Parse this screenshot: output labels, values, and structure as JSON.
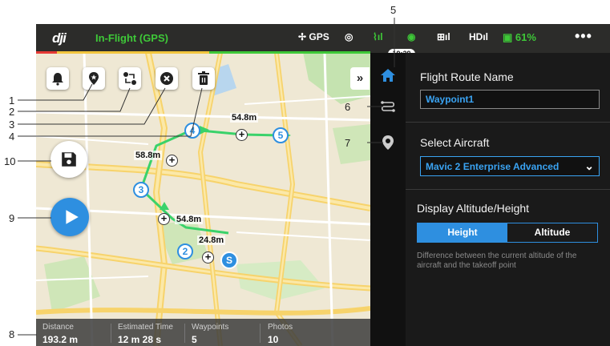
{
  "app": {
    "logo": "dji",
    "status": "In-Flight (GPS)"
  },
  "topbar": {
    "gps_label": "GPS",
    "battery": "61%",
    "more": "•••",
    "clock": "19:29"
  },
  "icons": {
    "bell": "bell-icon",
    "pin": "location-pin-icon",
    "swap": "route-order-icon",
    "close": "close-icon",
    "trash": "trash-icon",
    "save": "save-icon",
    "play": "play-icon",
    "home": "home-icon",
    "route": "route-icon",
    "marker": "map-marker-icon",
    "chevron": "chevron-down-icon"
  },
  "colors": {
    "accent": "#2e8fe0",
    "route": "#3ad26a",
    "status": "#3ec838"
  },
  "expand_label": "»",
  "panel": {
    "route_name_title": "Flight Route Name",
    "route_name_value": "Waypoint1",
    "aircraft_title": "Select Aircraft",
    "aircraft_value": "Mavic 2 Enterprise Advanced",
    "chevron": "⌄",
    "altitude_title": "Display Altitude/Height",
    "seg_height": "Height",
    "seg_altitude": "Altitude",
    "hint": "Difference between the current altitude of the aircraft and the takeoff point"
  },
  "route": {
    "waypoints": [
      "S",
      "2",
      "3",
      "4",
      "5"
    ],
    "distances": [
      "24.8m",
      "54.8m",
      "58.8m",
      "54.8m"
    ],
    "add_symbol": "+"
  },
  "stats": {
    "distance_label": "Distance",
    "distance_value": "193.2 m",
    "time_label": "Estimated Time",
    "time_value": "12 m 28 s",
    "waypoints_label": "Waypoints",
    "waypoints_value": "5",
    "photos_label": "Photos",
    "photos_value": "10"
  },
  "callouts": [
    "1",
    "2",
    "3",
    "4",
    "5",
    "6",
    "7",
    "8",
    "9",
    "10"
  ]
}
